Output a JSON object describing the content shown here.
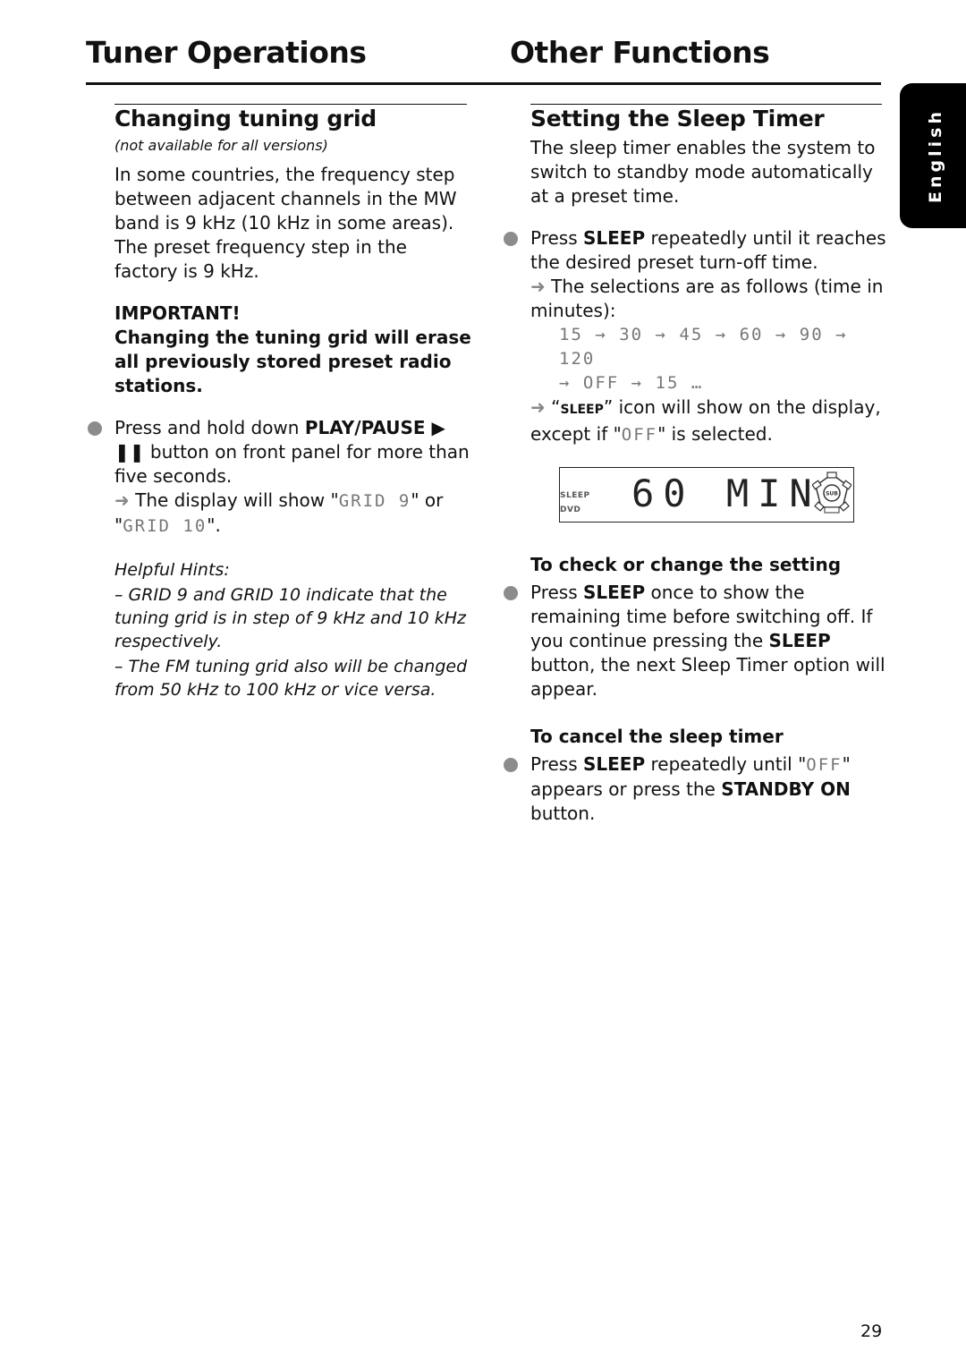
{
  "header": {
    "left_title": "Tuner Operations",
    "right_title": "Other Functions"
  },
  "language_tab": "English",
  "left_section": {
    "heading": "Changing tuning grid",
    "note": "(not available for all versions)",
    "intro": "In some countries, the frequency step between adjacent channels in the MW band is 9 kHz (10 kHz in some areas). The preset frequency step in the factory is 9 kHz.",
    "important_label": "IMPORTANT!",
    "important_text": "Changing the tuning grid will erase all previously stored preset radio stations.",
    "step": {
      "prefix": "Press and hold down ",
      "button": "PLAY/PAUSE ▶ ❚❚",
      "suffix": " button on front panel for more than five seconds.",
      "result_prefix": " The display will show \"",
      "display_1": "GRID 9",
      "result_middle": "\" or \"",
      "display_2": "GRID 10",
      "result_suffix": "\"."
    },
    "hints": {
      "title": "Helpful Hints:",
      "items": [
        "–  GRID 9 and GRID 10 indicate that the tuning grid is in step of 9 kHz and 10 kHz respectively.",
        "–  The FM tuning grid also will be changed from 50 kHz to 100 kHz or vice versa."
      ]
    }
  },
  "right_section": {
    "heading": "Setting the Sleep Timer",
    "intro": "The sleep timer enables the system to switch to standby mode automatically at a preset time.",
    "step1": {
      "prefix": "Press ",
      "button": "SLEEP",
      "suffix": " repeatedly until it reaches the desired preset turn-off time.",
      "result": " The selections are as follows (time in minutes):",
      "sequence_line1": "15 → 30 → 45 → 60 → 90 → 120",
      "sequence_line2": "→ OFF → 15 …",
      "icon_note_prefix": " “",
      "icon_note_name": "SLEEP",
      "icon_note_suffix": "” icon will show on the display, except if \"",
      "icon_note_off": "OFF",
      "icon_note_end": "\" is selected."
    },
    "display": {
      "indicator_sleep": "SLEEP",
      "indicator_dvd": "DVD",
      "readout": "60 MIN",
      "logo_text": "SUB"
    },
    "check": {
      "heading": "To check or change the setting",
      "prefix": "Press ",
      "button": "SLEEP",
      "middle": " once to show the remaining time before switching off. If you continue pressing the ",
      "button2": "SLEEP",
      "suffix": " button, the next Sleep Timer option will appear."
    },
    "cancel": {
      "heading": "To cancel the sleep timer",
      "prefix": "Press ",
      "button": "SLEEP",
      "middle": " repeatedly until \"",
      "display_off": "OFF",
      "middle2": "\" appears or press the ",
      "button2": "STANDBY ON",
      "suffix": " button."
    }
  },
  "page_number": "29",
  "colors": {
    "bullet": "#8c8c8c",
    "arrow": "#888888",
    "tab_background": "#000000"
  }
}
